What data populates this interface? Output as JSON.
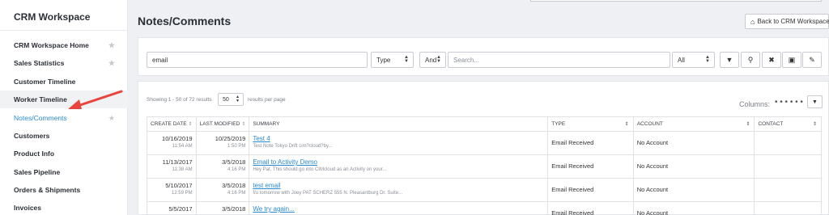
{
  "sidebar": {
    "title": "CRM Workspace",
    "items": [
      {
        "label": "CRM Workspace Home",
        "star": true
      },
      {
        "label": "Sales Statistics",
        "star": true
      },
      {
        "label": "Customer Timeline",
        "star": false
      },
      {
        "label": "Worker Timeline",
        "star": false
      },
      {
        "label": "Notes/Comments",
        "star": true
      },
      {
        "label": "Customers",
        "star": false
      },
      {
        "label": "Product Info",
        "star": false
      },
      {
        "label": "Sales Pipeline",
        "star": false
      },
      {
        "label": "Orders & Shipments",
        "star": false
      },
      {
        "label": "Invoices",
        "star": false
      }
    ]
  },
  "header": {
    "title": "Notes/Comments",
    "back_label": "Back to CRM Workspace"
  },
  "filter": {
    "keyword_value": "email",
    "field_select": "Type",
    "logic_select": "And",
    "search_placeholder": "Search...",
    "scope_select": "All"
  },
  "results": {
    "showing": "Showing 1 - 50 of 72 results",
    "per_page_value": "50",
    "per_page_label": "results per page",
    "columns_label": "Columns:",
    "columns_dots": "• • • • • •",
    "headers": {
      "create_date": "CREATE DATE",
      "last_modified": "LAST MODIFIED",
      "summary": "SUMMARY",
      "type": "TYPE",
      "account": "ACCOUNT",
      "contact": "CONTACT"
    },
    "rows": [
      {
        "create_date": "10/16/2019",
        "create_time": "11:54 AM",
        "modified_date": "10/25/2019",
        "modified_time": "1:50 PM",
        "title": "Test 4",
        "snippet": "Test Note Tokyo Drift cim?cloud?by...",
        "type": "Email Received",
        "account": "No Account",
        "contact": ""
      },
      {
        "create_date": "11/13/2017",
        "create_time": "11:38 AM",
        "modified_date": "3/5/2018",
        "modified_time": "4:16 PM",
        "title": "Email to Activity Demo",
        "snippet": "Hey Pat, This should go into CIMcloud as an Activity on your...",
        "type": "Email Received",
        "account": "No Account",
        "contact": ""
      },
      {
        "create_date": "5/10/2017",
        "create_time": "12:59 PM",
        "modified_date": "3/5/2018",
        "modified_time": "4:16 PM",
        "title": "test email",
        "snippet": "f/u tomorrow with Joey PAT SCHERZ 555 N. Pleasantburg Dr. Suite...",
        "type": "Email Received",
        "account": "No Account",
        "contact": ""
      },
      {
        "create_date": "5/5/2017",
        "create_time": "",
        "modified_date": "3/5/2018",
        "modified_time": "",
        "title": "We try again...",
        "snippet": "",
        "type": "Email Received",
        "account": "No Account",
        "contact": ""
      }
    ]
  },
  "colors": {
    "accent": "#2a8ad1",
    "annotation_arrow": "#e8453c"
  }
}
